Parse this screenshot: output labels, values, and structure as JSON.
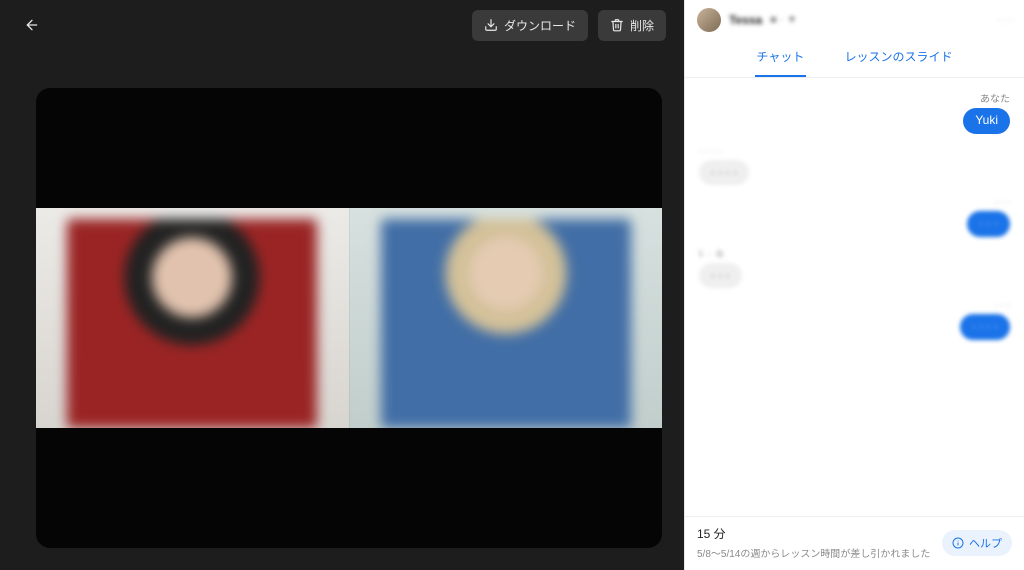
{
  "colors": {
    "accent": "#1a73e8",
    "dark_bg": "#1d1d1d"
  },
  "toolbar": {
    "download_label": "ダウンロード",
    "delete_label": "削除"
  },
  "header": {
    "name": "Tessa",
    "subtitle": "■ · ▼",
    "right_meta": "· · ·"
  },
  "tabs": {
    "chat": "チャット",
    "slides": "レッスンのスライド"
  },
  "chat": [
    {
      "side": "me",
      "sender": "あなた",
      "text": "Yuki",
      "blur": false
    },
    {
      "side": "them",
      "sender": "· · · ·",
      "text": "· · · ·",
      "blur": true
    },
    {
      "side": "me",
      "sender": "· · ·",
      "text": "· · ·",
      "blur": true
    },
    {
      "side": "them",
      "sender": "I· · ·b",
      "text": "· · ·",
      "blur": true
    },
    {
      "side": "me",
      "sender": "· · ·",
      "text": "· · · ·",
      "blur": true
    }
  ],
  "footer": {
    "duration": "15 分",
    "note": "5/8〜5/14の週からレッスン時間が差し引かれました",
    "help_label": "ヘルプ"
  }
}
